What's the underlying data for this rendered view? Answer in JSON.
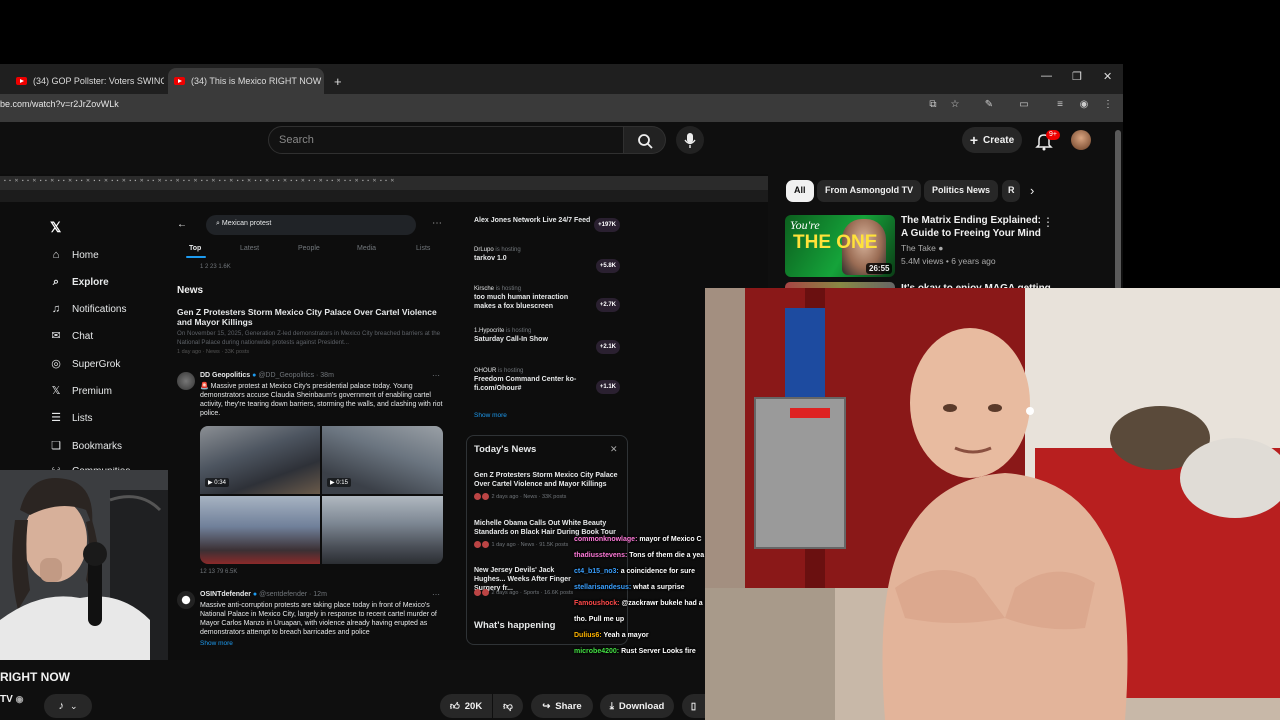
{
  "browser": {
    "tabs": [
      {
        "label": "(34) GOP Pollster: Voters SWING"
      },
      {
        "label": "(34) This is Mexico RIGHT NOW"
      }
    ],
    "new_tab": "+",
    "url": "be.com/watch?v=r2JrZovWLk"
  },
  "youtube": {
    "search_placeholder": "Search",
    "create_label": "Create",
    "notif_badge": "9+",
    "chips": [
      "All",
      "From Asmongold TV",
      "Politics News",
      "R"
    ],
    "recommendation": {
      "thumb_line1": "You're",
      "thumb_line2": "THE ONE",
      "duration": "26:55",
      "title": "The Matrix Ending Explained: A Guide to Freeing Your Mind",
      "channel": "The Take",
      "meta": "5.4M views • 6 years ago"
    },
    "recommendation2_title": "It's okay to enjoy MAGA getting...",
    "video_title": "RIGHT NOW",
    "channel_abbr": "TV",
    "actions": {
      "likes": "20K",
      "share": "Share",
      "download": "Download"
    }
  },
  "x_page": {
    "search_value": "Mexican protest",
    "tabs": [
      "Top",
      "Latest",
      "People",
      "Media",
      "Lists"
    ],
    "nav": [
      "Home",
      "Explore",
      "Notifications",
      "Chat",
      "SuperGrok",
      "Premium",
      "Lists",
      "Bookmarks",
      "Communities"
    ],
    "top_stats": "1   2   23   1.6K",
    "news_header": "News",
    "news_headline": "Gen Z Protesters Storm Mexico City Palace Over Cartel Violence and Mayor Killings",
    "news_snippet": "On November 15, 2025, Generation Z-led demonstrators in Mexico City breached barriers at the National Palace during nationwide protests against President...",
    "news_meta": "1 day ago · News · 33K posts",
    "post1": {
      "name": "DD Geopolitics",
      "handle": "@DD_Geopolitics · 38m",
      "text": "🚨 Massive protest at Mexico City's presidential palace today. Young demonstrators accuse Claudia Sheinbaum's government of enabling cartel activity, they're tearing down barriers, storming the walls, and clashing with riot police.",
      "video1": "0:34",
      "video2": "0:15",
      "actions": "12   13   79   6.5K"
    },
    "post2": {
      "name": "OSINTdefender",
      "handle": "@sentdefender · 12m",
      "text": "Massive anti-corruption protests are taking place today in front of Mexico's National Palace in Mexico City, largely in response to recent cartel murder of Mayor Carlos Manzo in Uruapan, with violence already having erupted as demonstrators attempt to breach barricades and police",
      "show_more": "Show more"
    },
    "live": [
      {
        "title": "Alex Jones Network Live 24/7 Feed",
        "host": "",
        "count": "+197K"
      },
      {
        "title": "tarkov 1.0",
        "host": "DrLupo",
        "count": "+5.8K"
      },
      {
        "title": "too much human interaction makes a fox bluescreen",
        "host": "Kirsche",
        "count": "+2.7K"
      },
      {
        "title": "Saturday Call-In Show",
        "host": "1.Hypocrite",
        "count": "+2.1K"
      },
      {
        "title": "Freedom Command Center ko-fi.com/Ohour#",
        "host": "OHOUR",
        "count": "+1.1K"
      }
    ],
    "host_suffix": "is hosting",
    "show_more_live": "Show more",
    "todays_news_header": "Today's News",
    "todays_news": [
      {
        "title": "Gen Z Protesters Storm Mexico City Palace Over Cartel Violence and Mayor Killings",
        "meta": "2 days ago · News · 33K posts"
      },
      {
        "title": "Michelle Obama Calls Out White Beauty Standards on Black Hair During Book Tour",
        "meta": "1 day ago · News · 91.5K posts"
      },
      {
        "title": "New Jersey Devils' Jack Hughes... Weeks After Finger Surgery fr...",
        "meta": "2 days ago · Sports · 16.6K posts"
      }
    ],
    "whats_happening": "What's happening"
  },
  "chat": [
    {
      "user": "commonknowlage:",
      "msg": "mayor of Mexico C",
      "color": "#ff7ad9"
    },
    {
      "user": "thadiusstevens:",
      "msg": "Tons of them die a yea",
      "color": "#ff7ad9"
    },
    {
      "user": "ct4_b15_no3:",
      "msg": "a coincidence for sure",
      "color": "#3aa0ff"
    },
    {
      "user": "stellarisandesus:",
      "msg": "what a surprise",
      "color": "#3aa0ff"
    },
    {
      "user": "Famoushock:",
      "msg": "@zackrawr bukele had a",
      "color": "#ff4a4a"
    },
    {
      "user": "",
      "msg": "tho. Pull me up",
      "color": "#ffffff"
    },
    {
      "user": "Dulius6:",
      "msg": "Yeah a mayor",
      "color": "#ffb400"
    },
    {
      "user": "microbe4200:",
      "msg": "Rust Server Looks fire",
      "color": "#43e043"
    }
  ],
  "colors": {
    "yt_bg": "#0f0f0f",
    "x_blue": "#1d9bf0",
    "badge_red": "#e00000"
  }
}
